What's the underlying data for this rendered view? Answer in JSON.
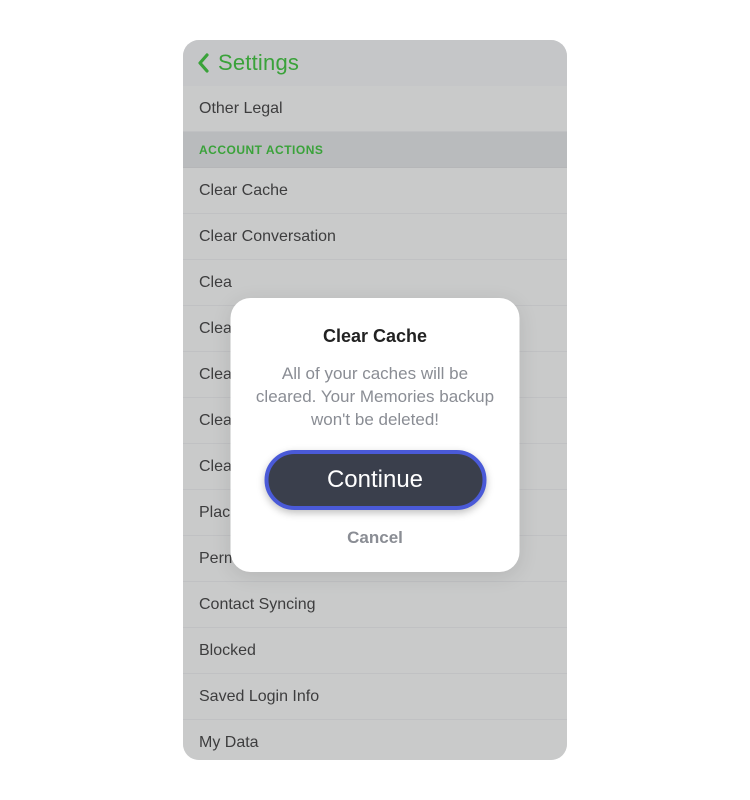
{
  "header": {
    "title": "Settings"
  },
  "list": {
    "items": [
      {
        "label": "Other Legal",
        "type": "item"
      },
      {
        "label": "ACCOUNT ACTIONS",
        "type": "section"
      },
      {
        "label": "Clear Cache",
        "type": "item"
      },
      {
        "label": "Clear Conversation",
        "type": "item"
      },
      {
        "label": "Clea",
        "type": "item"
      },
      {
        "label": "Clea",
        "type": "item"
      },
      {
        "label": "Clea",
        "type": "item"
      },
      {
        "label": "Clea",
        "type": "item"
      },
      {
        "label": "Clea",
        "type": "item"
      },
      {
        "label": "Place",
        "type": "item"
      },
      {
        "label": "Permissions",
        "type": "item"
      },
      {
        "label": "Contact Syncing",
        "type": "item"
      },
      {
        "label": "Blocked",
        "type": "item"
      },
      {
        "label": "Saved Login Info",
        "type": "item"
      },
      {
        "label": "My Data",
        "type": "item"
      }
    ]
  },
  "modal": {
    "title": "Clear Cache",
    "body": "All of your caches will be cleared. Your Memories backup won't be deleted!",
    "continue_label": "Continue",
    "cancel_label": "Cancel"
  }
}
